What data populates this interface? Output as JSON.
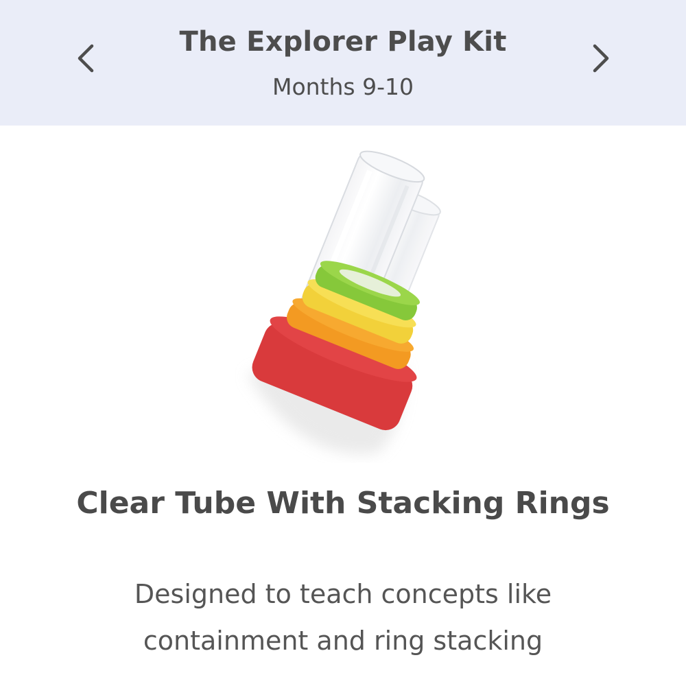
{
  "header": {
    "title": "The Explorer Play Kit",
    "subtitle": "Months 9-10",
    "prev_icon": "chevron-left-icon",
    "next_icon": "chevron-right-icon",
    "background": "#eaedf8"
  },
  "product": {
    "name": "Clear Tube With Stacking Rings",
    "description": "Designed to teach concepts like containment and ring stacking",
    "ring_colors": [
      "#d83a3a",
      "#f39b25",
      "#f2d23a",
      "#8fcf3c"
    ]
  }
}
